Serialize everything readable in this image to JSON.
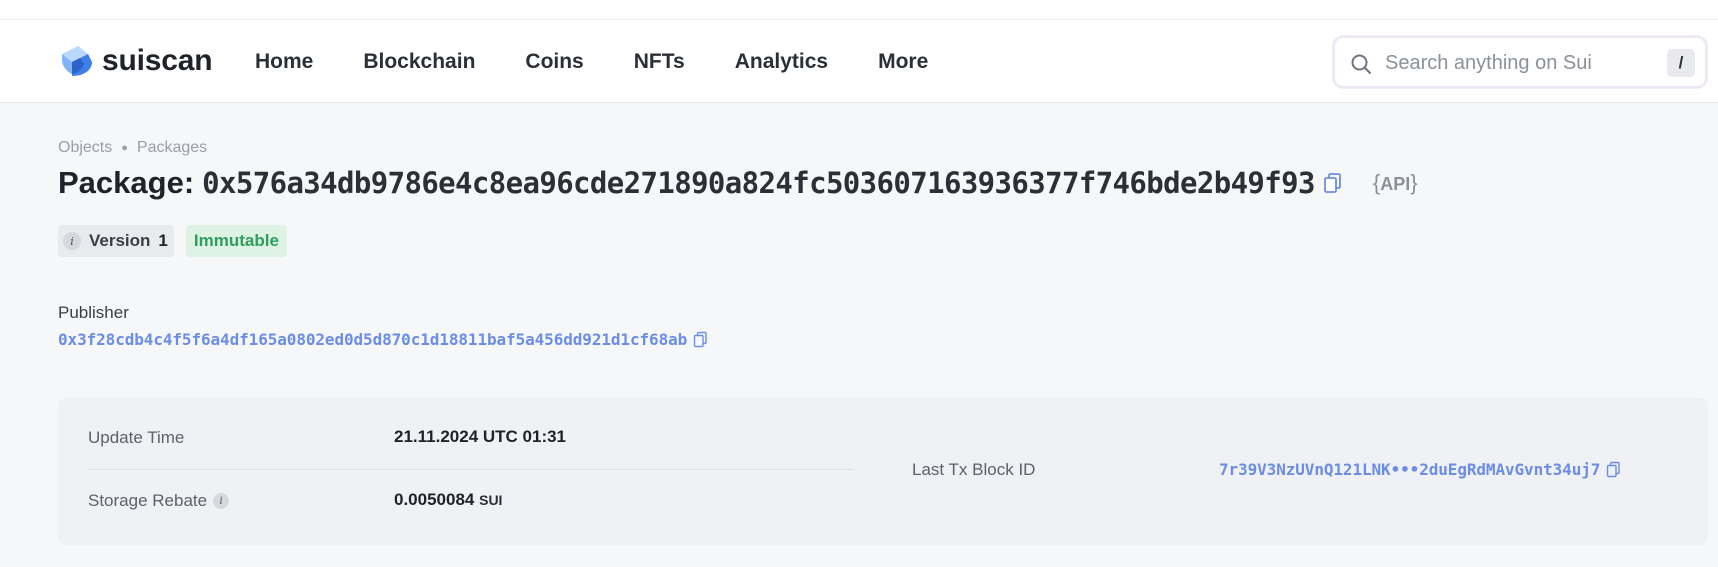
{
  "header": {
    "logo_text": "suiscan",
    "nav": [
      "Home",
      "Blockchain",
      "Coins",
      "NFTs",
      "Analytics",
      "More"
    ],
    "search": {
      "placeholder": "Search anything on Sui",
      "shortcut": "/"
    }
  },
  "breadcrumb": [
    "Objects",
    "Packages"
  ],
  "title": {
    "label": "Package:",
    "id": "0x576a34db9786e4c8ea96cde271890a824fc503607163936377f746bde2b49f93",
    "api_label": "API"
  },
  "badges": {
    "version_label": "Version",
    "version_value": "1",
    "status": "Immutable"
  },
  "publisher": {
    "label": "Publisher",
    "address": "0x3f28cdb4c4f5f6a4df165a0802ed0d5d870c1d18811baf5a456dd921d1cf68ab"
  },
  "details": {
    "update_time_label": "Update Time",
    "update_time_value": "21.11.2024 UTC 01:31",
    "storage_rebate_label": "Storage Rebate",
    "storage_rebate_value": "0.0050084",
    "storage_rebate_unit": "SUI",
    "last_tx_label": "Last Tx Block ID",
    "last_tx_value": "7r39V3NzUVnQ121LNK•••2duEgRdMAvGvnt34uj7"
  },
  "colors": {
    "accent_link": "#6b8de6",
    "immutable_bg": "#dff3e5",
    "immutable_text": "#2e9e5e",
    "logo_blue": "#4a8af0"
  }
}
